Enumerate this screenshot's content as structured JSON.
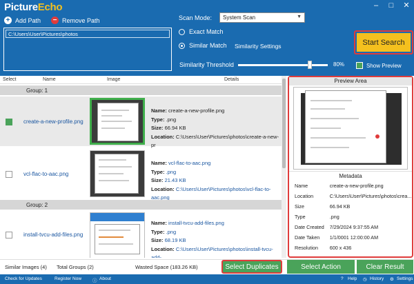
{
  "app": {
    "title": "PictureEcho",
    "window_controls": [
      "–",
      "□",
      "✕"
    ]
  },
  "top": {
    "add_path": "Add Path",
    "remove_path": "Remove Path",
    "path_item": "C:\\Users\\User\\Pictures\\photos",
    "scan_mode_label": "Scan Mode:",
    "scan_mode_value": "System Scan",
    "exact_match": "Exact Match",
    "similar_match": "Similar Match",
    "similarity_settings": "Similarity Settings",
    "threshold_label": "Similarity Threshold",
    "threshold_value": "80%",
    "threshold_fraction": 0.8,
    "start_search": "Start Search",
    "show_preview": "Show Preview"
  },
  "columns": [
    "Select",
    "Name",
    "Image",
    "Details"
  ],
  "groups": [
    {
      "label": "Group: 1",
      "items": [
        {
          "selected": true,
          "name": "create-a-new-profile.png",
          "name_label": "Name:",
          "type_label": "Type:",
          "size_label": "Size:",
          "location_label": "Location:",
          "type": ".png",
          "size": "66.94 KB",
          "location": "C:\\Users\\User\\Pictures\\photos\\create-a-new-pr"
        },
        {
          "selected": false,
          "name": "vcl-flac-to-aac.png",
          "name_label": "Name:",
          "type_label": "Type:",
          "size_label": "Size:",
          "location_label": "Location:",
          "type": ".png",
          "size": "21.43 KB",
          "location": "C:\\Users\\User\\Pictures\\photos\\vcl-flac-to-aac.png"
        }
      ]
    },
    {
      "label": "Group: 2",
      "items": [
        {
          "selected": false,
          "name": "install-tvcu-add-files.png",
          "name_label": "Name:",
          "type_label": "Type:",
          "size_label": "Size:",
          "location_label": "Location:",
          "type": ".png",
          "size": "68.19 KB",
          "location": "C:\\Users\\User\\Pictures\\photos\\install-tvcu-add-"
        }
      ]
    }
  ],
  "preview": {
    "header": "Preview Area",
    "metadata_header": "Metadata",
    "meta": [
      {
        "k": "Name",
        "v": "create-a-new-profile.png"
      },
      {
        "k": "Location",
        "v": "C:\\Users\\User\\Pictures\\photos\\crea..."
      },
      {
        "k": "Size",
        "v": "66.94 KB"
      },
      {
        "k": "Type",
        "v": ".png"
      },
      {
        "k": "Date Created",
        "v": "7/29/2024 9:37:55 AM"
      },
      {
        "k": "Date Taken",
        "v": "1/1/0001 12:00:00 AM"
      },
      {
        "k": "Resolution",
        "v": "600 x 436"
      }
    ]
  },
  "status": {
    "similar_images": "Similar Images (4)",
    "total_groups": "Total Groups (2)",
    "wasted_space": "Wasted Space (183.26 KB)",
    "select_duplicates": "Select Duplicates",
    "select_action": "Select Action",
    "clear_result": "Clear Result"
  },
  "footer": {
    "check_updates": "Check for Updates",
    "register": "Register Now",
    "about": "About",
    "help": "Help",
    "history": "History",
    "settings": "Settings"
  },
  "colors": {
    "brand_blue": "#1a6bb0",
    "accent_green": "#4aa35a",
    "start_yellow": "#f4c01e",
    "highlight_red": "#e03b3b"
  }
}
